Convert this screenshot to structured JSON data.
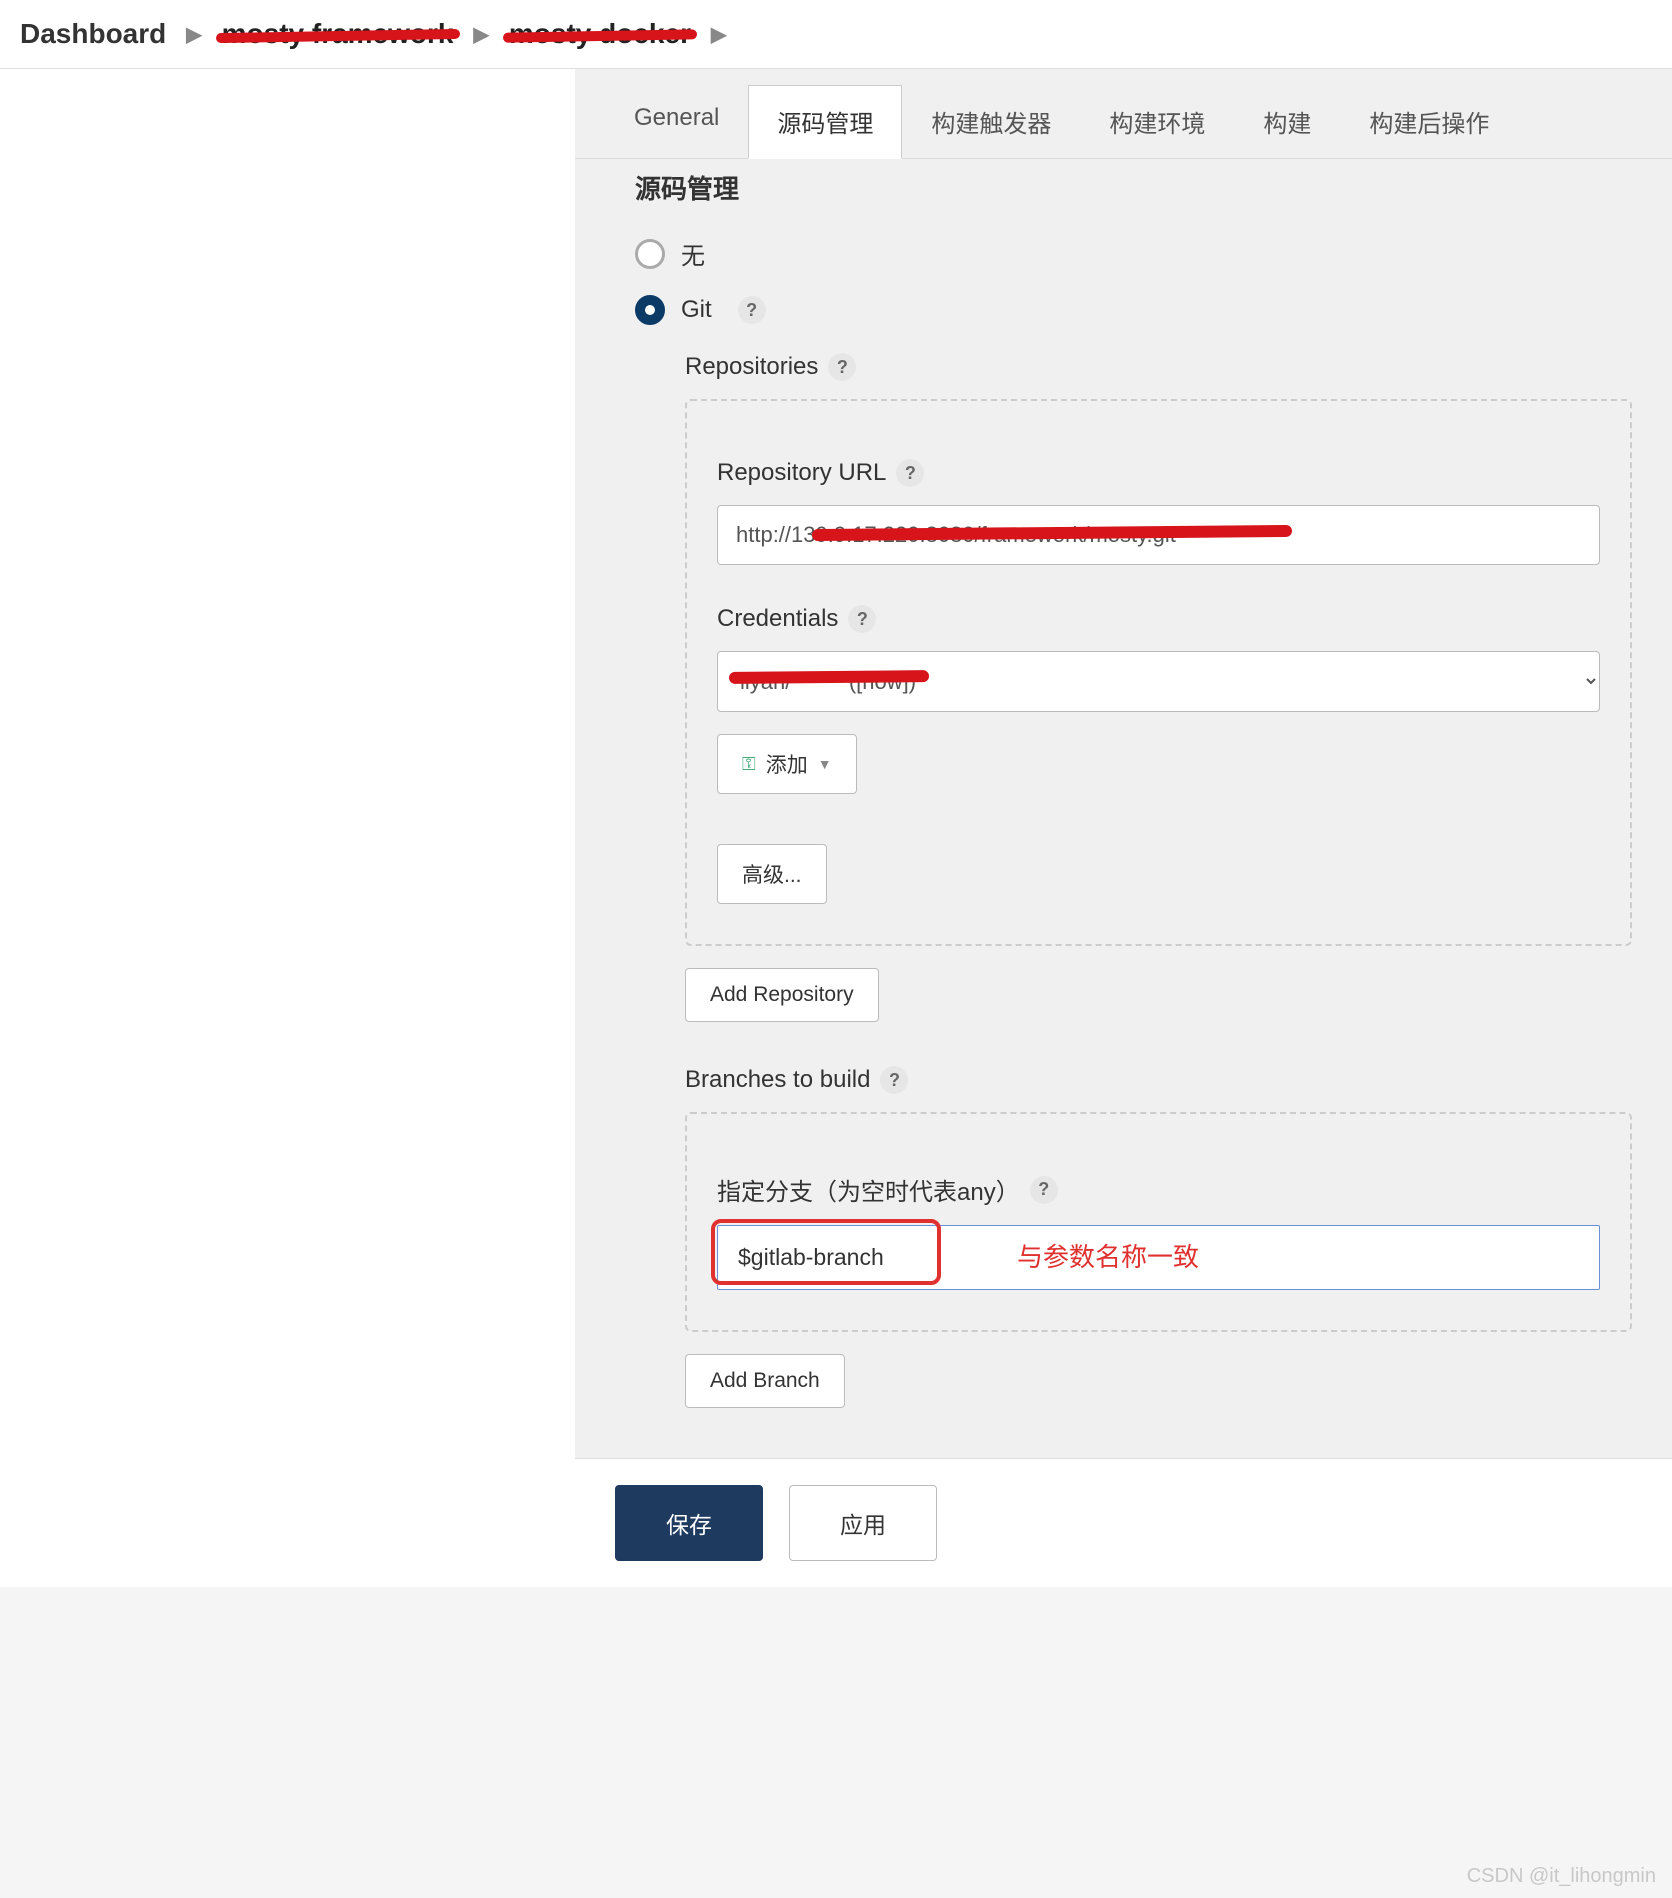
{
  "breadcrumb": {
    "dashboard": "Dashboard",
    "item1": "mosty framework",
    "item2": "mosty docker"
  },
  "tabs": [
    "General",
    "源码管理",
    "构建触发器",
    "构建环境",
    "构建",
    "构建后操作"
  ],
  "scm": {
    "section_title": "源码管理",
    "none_label": "无",
    "git_label": "Git",
    "repositories_label": "Repositories",
    "repo_url_label": "Repository URL",
    "repo_url_value": "http://139.9.17.220:8080/framework/mosty.git",
    "credentials_label": "Credentials",
    "credentials_value": "liyan/****** ([now])",
    "add_label": "添加",
    "advanced_label": "高级...",
    "add_repo_label": "Add Repository",
    "branches_label": "Branches to build",
    "branch_spec_label": "指定分支（为空时代表any）",
    "branch_value": "$gitlab-branch",
    "annotation": "与参数名称一致",
    "add_branch_label": "Add Branch"
  },
  "footer": {
    "save": "保存",
    "apply": "应用"
  },
  "watermark": "CSDN @it_lihongmin"
}
